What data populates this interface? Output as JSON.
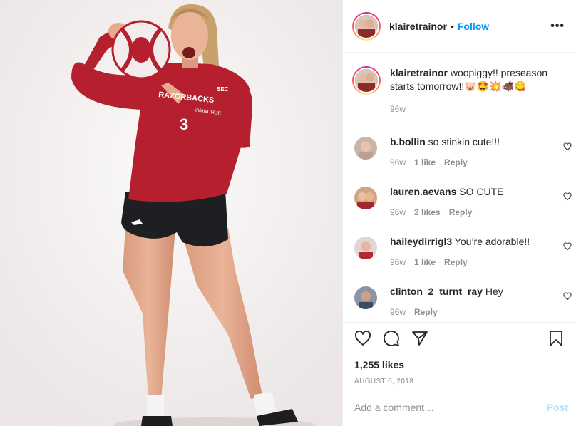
{
  "post": {
    "author": "klairetrainor",
    "follow_label": "Follow",
    "separator": "•",
    "more_label": "•••"
  },
  "caption": {
    "username": "klairetrainor",
    "text": " woopiggy!! preseason starts tomorrow!!🐷🤩💥🐗😋",
    "time": "96w"
  },
  "comments": [
    {
      "username": "b.bollin",
      "text": " so stinkin cute!!!",
      "time": "96w",
      "likes": "1 like",
      "reply": "Reply"
    },
    {
      "username": "lauren.aevans",
      "text": " SO CUTE",
      "time": "96w",
      "likes": "2 likes",
      "reply": "Reply"
    },
    {
      "username": "haileydirrigl3",
      "text": " You’re adorable!!",
      "time": "96w",
      "likes": "1 like",
      "reply": "Reply"
    },
    {
      "username": "clinton_2_turnt_ray",
      "text": " Hey",
      "time": "96w",
      "likes": "",
      "reply": "Reply"
    }
  ],
  "actions": {
    "likes": "1,255 likes",
    "date": "AUGUST 6, 2018"
  },
  "add_comment": {
    "placeholder": "Add a comment…",
    "post_label": "Post"
  },
  "photo": {
    "jersey_text": "RAZORBACKS",
    "jersey_patch": "SEC",
    "jersey_name": "SVANCHUK",
    "jersey_number": "3"
  },
  "colors": {
    "link": "#0095f6",
    "secondary": "#8e8e8e",
    "post_disabled": "#b2dffc",
    "jersey_red": "#b51f2e"
  }
}
